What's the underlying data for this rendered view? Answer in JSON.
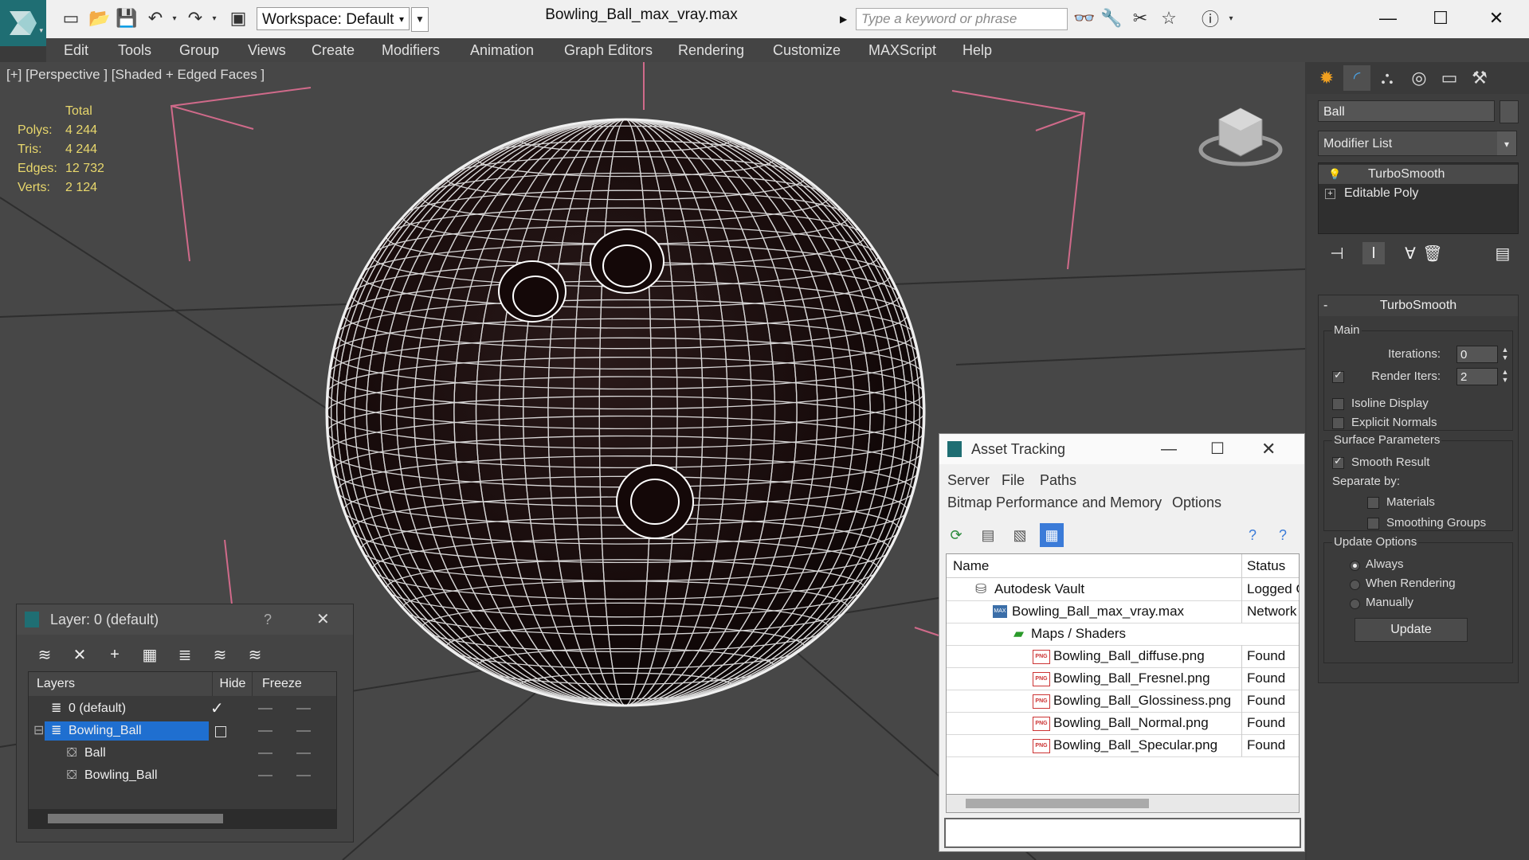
{
  "window": {
    "title": "Bowling_Ball_max_vray.max",
    "workspace_label": "Workspace: Default",
    "search_placeholder": "Type a keyword or phrase"
  },
  "menubar": [
    "Edit",
    "Tools",
    "Group",
    "Views",
    "Create",
    "Modifiers",
    "Animation",
    "Graph Editors",
    "Rendering",
    "Customize",
    "MAXScript",
    "Help"
  ],
  "viewport": {
    "label": "[+] [Perspective ] [Shaded + Edged Faces ]",
    "stats_header": "Total",
    "stats": [
      {
        "label": "Polys:",
        "value": "4 244"
      },
      {
        "label": "Tris:",
        "value": "4 244"
      },
      {
        "label": "Edges:",
        "value": "12 732"
      },
      {
        "label": "Verts:",
        "value": "2 124"
      }
    ]
  },
  "command_panel": {
    "object_name": "Ball",
    "modifier_list": "Modifier List",
    "stack": [
      "TurboSmooth",
      "Editable Poly"
    ],
    "turbosmooth": {
      "title": "TurboSmooth",
      "main_group": "Main",
      "iterations_label": "Iterations:",
      "iterations_value": "0",
      "render_iters_label": "Render Iters:",
      "render_iters_value": "2",
      "isoline_label": "Isoline Display",
      "explicit_normals_label": "Explicit Normals",
      "surface_group": "Surface Parameters",
      "smooth_result_label": "Smooth Result",
      "separate_by_label": "Separate by:",
      "materials_label": "Materials",
      "smoothing_groups_label": "Smoothing Groups",
      "update_group": "Update Options",
      "always_label": "Always",
      "when_rendering_label": "When Rendering",
      "manually_label": "Manually",
      "update_button": "Update"
    }
  },
  "layer_window": {
    "title": "Layer: 0 (default)",
    "help": "?",
    "columns": {
      "layers": "Layers",
      "hide": "Hide",
      "freeze": "Freeze"
    },
    "rows": [
      {
        "name": "0 (default)",
        "indent": 0
      },
      {
        "name": "Bowling_Ball",
        "indent": 0
      },
      {
        "name": "Ball",
        "indent": 1
      },
      {
        "name": "Bowling_Ball",
        "indent": 1
      }
    ]
  },
  "asset_tracking": {
    "title": "Asset Tracking",
    "menu_row1": [
      "Server",
      "File",
      "Paths"
    ],
    "menu_row2": [
      "Bitmap Performance and Memory",
      "Options"
    ],
    "columns": {
      "name": "Name",
      "status": "Status"
    },
    "rows": [
      {
        "name": "Autodesk Vault",
        "status": "Logged Out",
        "indent": 0
      },
      {
        "name": "Bowling_Ball_max_vray.max",
        "status": "Network",
        "indent": 1
      },
      {
        "name": "Maps / Shaders",
        "status": "",
        "indent": 2
      },
      {
        "name": "Bowling_Ball_diffuse.png",
        "status": "Found",
        "indent": 3
      },
      {
        "name": "Bowling_Ball_Fresnel.png",
        "status": "Found",
        "indent": 3
      },
      {
        "name": "Bowling_Ball_Glossiness.png",
        "status": "Found",
        "indent": 3
      },
      {
        "name": "Bowling_Ball_Normal.png",
        "status": "Found",
        "indent": 3
      },
      {
        "name": "Bowling_Ball_Specular.png",
        "status": "Found",
        "indent": 3
      }
    ]
  },
  "colors": {
    "stats_text": "#e8d76c",
    "selection": "#1f6fd0",
    "brand_teal": "#1f6e73"
  }
}
